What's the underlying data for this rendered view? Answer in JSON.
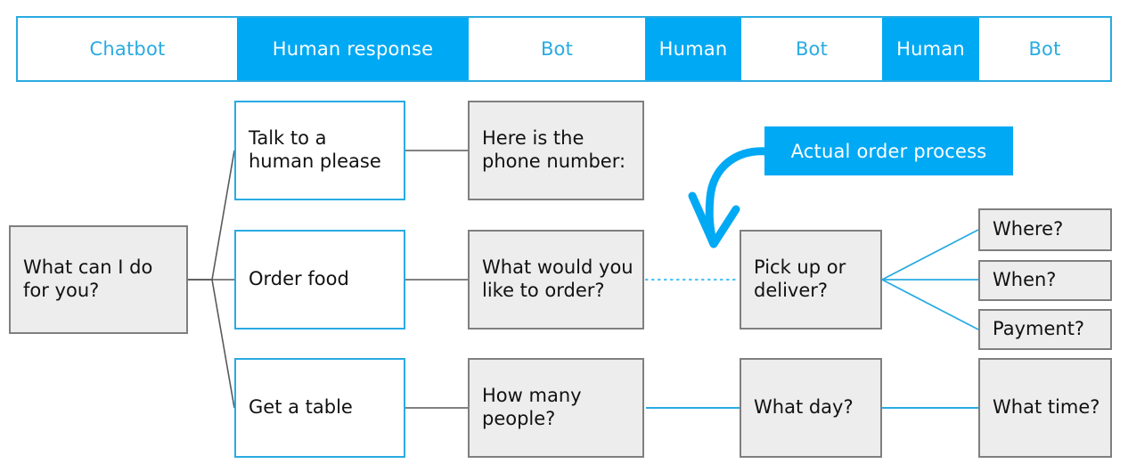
{
  "colors": {
    "accent_blue": "#00A9F4",
    "border_blue": "#29ABE2",
    "node_gray_fill": "#EDEDED",
    "node_gray_border": "#7F7F7F",
    "link_gray": "#595959",
    "page_background": "#FFFFFF"
  },
  "header": {
    "tabs": [
      {
        "label": "Chatbot",
        "style": "light"
      },
      {
        "label": "Human response",
        "style": "solid"
      },
      {
        "label": "Bot",
        "style": "light"
      },
      {
        "label": "Human",
        "style": "solid"
      },
      {
        "label": "Bot",
        "style": "light"
      },
      {
        "label": "Human",
        "style": "solid"
      },
      {
        "label": "Bot",
        "style": "light"
      }
    ]
  },
  "callout": {
    "label": "Actual order process",
    "arrow_icon": "curved-arrow-down-left-icon"
  },
  "diagram": {
    "nodes": {
      "root": {
        "label": "What can I do for you?"
      },
      "talk_human": {
        "label": "Talk to a human please"
      },
      "order_food": {
        "label": "Order food"
      },
      "get_table": {
        "label": "Get a table"
      },
      "phone_number": {
        "label": "Here is the phone number:"
      },
      "what_order": {
        "label": "What would you like to order?"
      },
      "how_many": {
        "label": "How many people?"
      },
      "pickup_deliver": {
        "label": "Pick up or deliver?"
      },
      "what_day": {
        "label": "What day?"
      },
      "where": {
        "label": "Where?"
      },
      "when": {
        "label": "When?"
      },
      "payment": {
        "label": "Payment?"
      },
      "what_time": {
        "label": "What time?"
      }
    }
  }
}
